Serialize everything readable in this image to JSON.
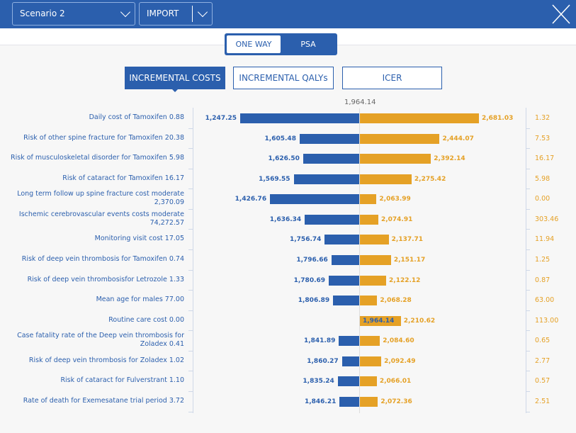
{
  "header": {
    "scenario": "Scenario 2",
    "import_label": "IMPORT"
  },
  "mode_toggle": [
    "ONE WAY",
    "PSA"
  ],
  "tabs": [
    "INCREMENTAL COSTS",
    "INCREMENTAL QALYs",
    "ICER"
  ],
  "colors": {
    "brand": "#2b5fad",
    "low": "#2b5fad",
    "high": "#e5a126"
  },
  "chart_data": {
    "type": "tornado",
    "base_value": 1964.14,
    "base_label": "1,964.14",
    "parameters": [
      "Daily cost of Tamoxifen 0.88",
      "Risk of other spine fracture for Tamoxifen 20.38",
      "Risk of musculoskeletal disorder for Tamoxifen 5.98",
      "Risk of cataract for Tamoxifen 16.17",
      "Long term follow up spine fracture cost moderate 2,370.09",
      "Ischemic cerebrovascular events costs moderate 74,272.57",
      "Monitoring visit cost 17.05",
      "Risk of deep vein thrombosis for Tamoxifen 0.74",
      "Risk of deep vein thrombosisfor Letrozole 1.33",
      "Mean age for males 77.00",
      "Routine care cost 0.00",
      "Case fatality rate of the Deep vein thrombosis for Zoladex 0.41",
      "Risk of deep vein thrombosis for Zoladex 1.02",
      "Risk of cataract for Fulverstrant 1.10",
      "Rate of death for Exemesatane trial period 3.72"
    ],
    "low": [
      1247.25,
      1605.48,
      1626.5,
      1569.55,
      1426.76,
      1636.34,
      1756.74,
      1796.66,
      1780.69,
      1806.89,
      1964.14,
      1841.89,
      1860.27,
      1835.24,
      1846.21
    ],
    "high": [
      2681.03,
      2444.07,
      2392.14,
      2275.42,
      2063.99,
      2074.91,
      2137.71,
      2151.17,
      2122.12,
      2068.28,
      2210.62,
      2084.6,
      2092.49,
      2066.01,
      2072.36
    ],
    "low_labels": [
      "1,247.25",
      "1,605.48",
      "1,626.50",
      "1,569.55",
      "1,426.76",
      "1,636.34",
      "1,756.74",
      "1,796.66",
      "1,780.69",
      "1,806.89",
      "1,964.14",
      "1,841.89",
      "1,860.27",
      "1,835.24",
      "1,846.21"
    ],
    "high_labels": [
      "2,681.03",
      "2,444.07",
      "2,392.14",
      "2,275.42",
      "2,063.99",
      "2,074.91",
      "2,137.71",
      "2,151.17",
      "2,122.12",
      "2,068.28",
      "2,210.62",
      "2,084.60",
      "2,092.49",
      "2,066.01",
      "2,072.36"
    ],
    "right_values": [
      "1.32",
      "7.53",
      "16.17",
      "5.98",
      "0.00",
      "303.46",
      "11.94",
      "1.25",
      "0.87",
      "63.00",
      "113.00",
      "0.65",
      "2.77",
      "0.57",
      "2.51"
    ]
  }
}
